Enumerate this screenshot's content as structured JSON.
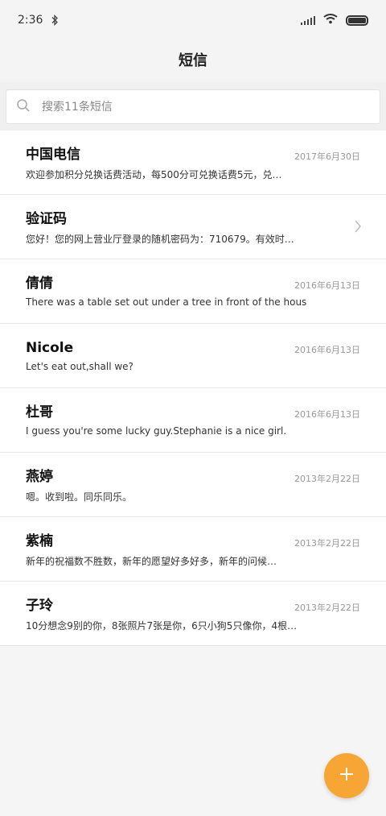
{
  "status": {
    "time": "2:36",
    "icons": [
      "bluetooth-icon",
      "signal-icon",
      "wifi-icon",
      "battery-icon"
    ]
  },
  "appbar": {
    "title": "短信"
  },
  "search": {
    "placeholder": "搜索11条短信"
  },
  "messages": [
    {
      "name": "中国电信",
      "preview": "欢迎参加积分兑换话费活动，每500分可兑换话费5元，兑…",
      "date": "2017年6月30日"
    },
    {
      "name": "验证码",
      "preview": "您好！您的网上营业厅登录的随机密码为：710679。有效时…",
      "date": ""
    },
    {
      "name": "倩倩",
      "preview": "There was a table set out under a tree in front of the hous",
      "date": "2016年6月13日"
    },
    {
      "name": "Nicole",
      "preview": "Let's eat out,shall we?",
      "date": "2016年6月13日"
    },
    {
      "name": "杜哥",
      "preview": "I guess you're some lucky guy.Stephanie is a nice girl.",
      "date": "2016年6月13日"
    },
    {
      "name": "燕婷",
      "preview": "嗯。收到啦。同乐同乐。",
      "date": "2013年2月22日"
    },
    {
      "name": "紫楠",
      "preview": "新年的祝福数不胜数，新年的愿望好多好多，新年的问候…",
      "date": "2013年2月22日"
    },
    {
      "name": "子玲",
      "preview": "10分想念9别的你，8张照片7张是你，6只小狗5只像你，4根…",
      "date": "2013年2月22日"
    }
  ],
  "colors": {
    "fab": "#f7a534",
    "background": "#f5f5f5"
  }
}
